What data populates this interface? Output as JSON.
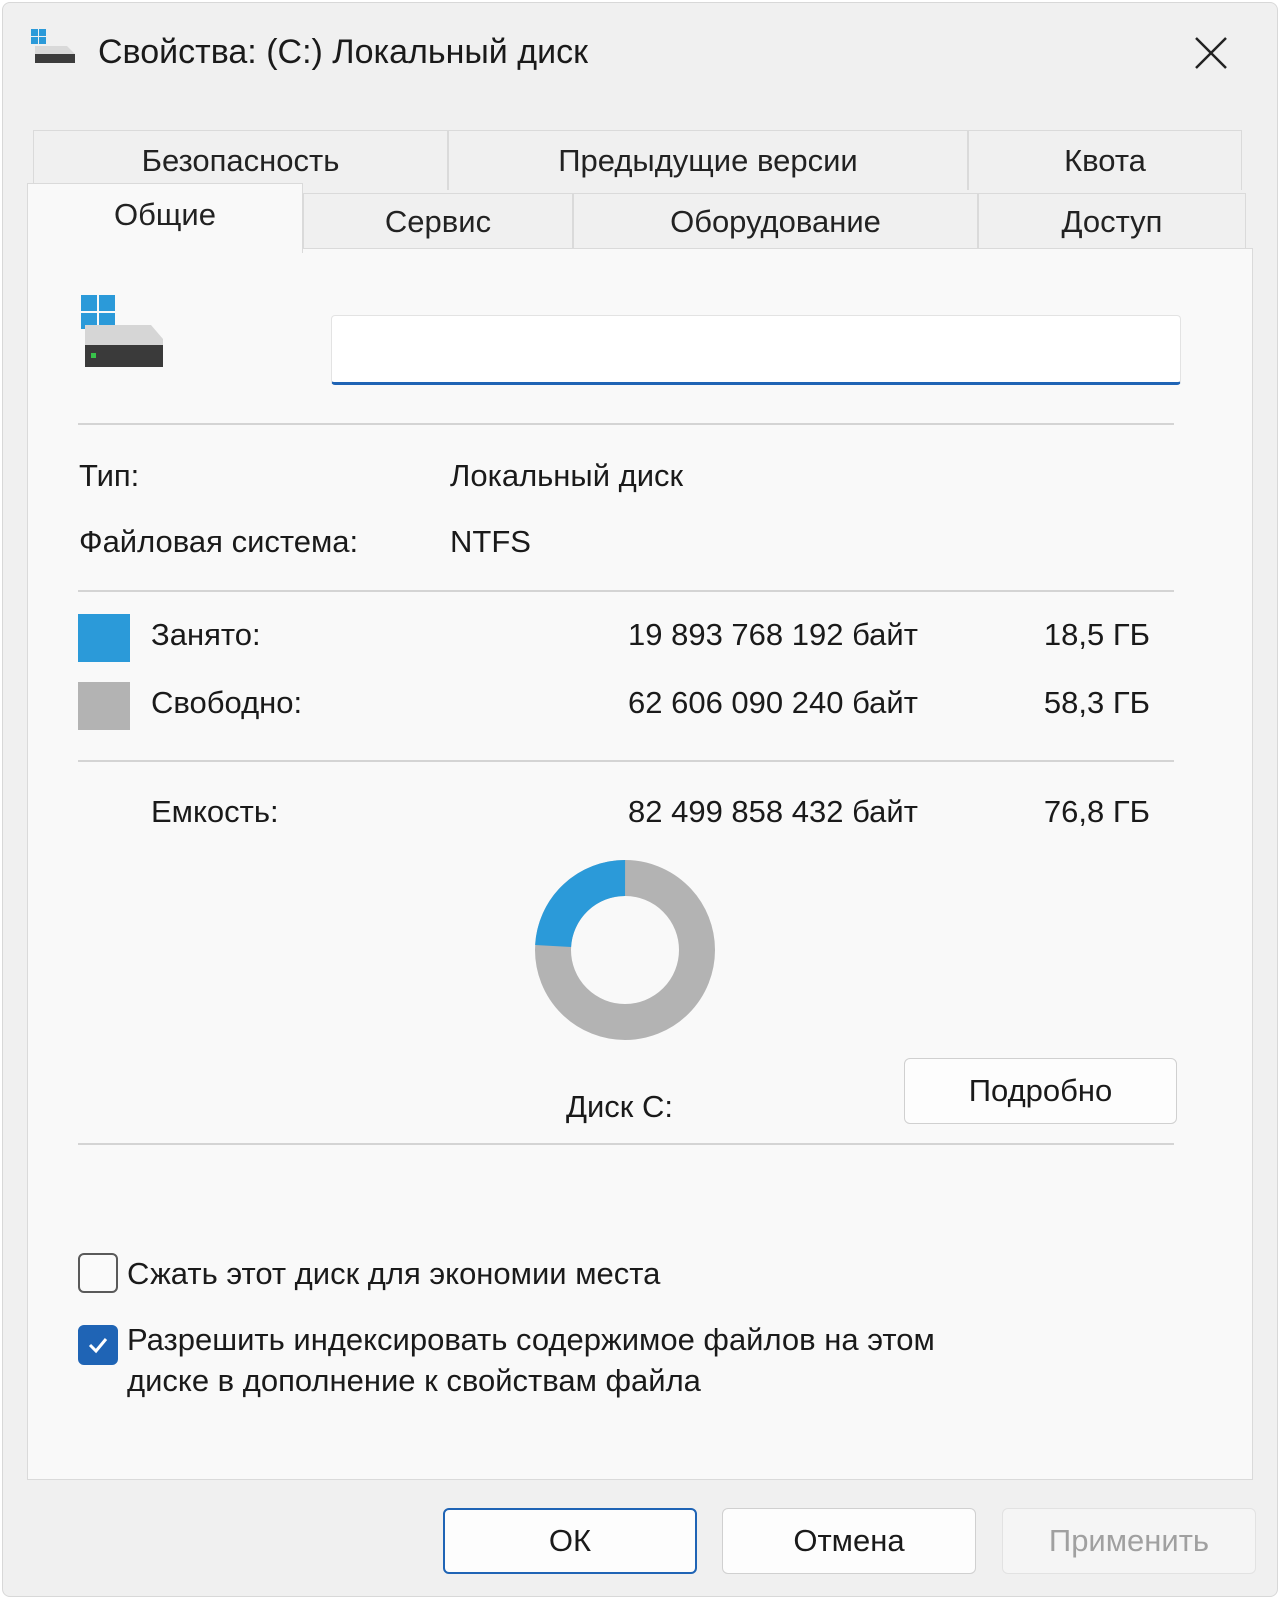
{
  "window": {
    "title": "Свойства: (C:) Локальный диск"
  },
  "tabs": {
    "row1": [
      {
        "label": "Безопасность"
      },
      {
        "label": "Предыдущие версии"
      },
      {
        "label": "Квота"
      }
    ],
    "row2": [
      {
        "label": "Общие",
        "active": true
      },
      {
        "label": "Сервис"
      },
      {
        "label": "Оборудование"
      },
      {
        "label": "Доступ"
      }
    ]
  },
  "general": {
    "name_value": "",
    "type_label": "Тип:",
    "type_value": "Локальный диск",
    "fs_label": "Файловая система:",
    "fs_value": "NTFS",
    "used": {
      "label": "Занято:",
      "bytes": "19 893 768 192 байт",
      "size": "18,5 ГБ",
      "color": "#2b9ad9"
    },
    "free": {
      "label": "Свободно:",
      "bytes": "62 606 090 240 байт",
      "size": "58,3 ГБ",
      "color": "#b3b3b3"
    },
    "capacity": {
      "label": "Емкость:",
      "bytes": "82 499 858 432 байт",
      "size": "76,8 ГБ"
    },
    "donut_used_fraction": 0.2411,
    "disk_label": "Диск C:",
    "details_button": "Подробно",
    "compress": {
      "label": "Сжать этот диск для экономии места",
      "checked": false
    },
    "index": {
      "label_line1": "Разрешить индексировать содержимое файлов на этом",
      "label_line2": "диске в дополнение к свойствам файла",
      "checked": true
    }
  },
  "footer": {
    "ok": "ОК",
    "cancel": "Отмена",
    "apply": "Применить"
  },
  "colors": {
    "accent": "#1f64b5",
    "used": "#2b9ad9",
    "free": "#b3b3b3"
  }
}
